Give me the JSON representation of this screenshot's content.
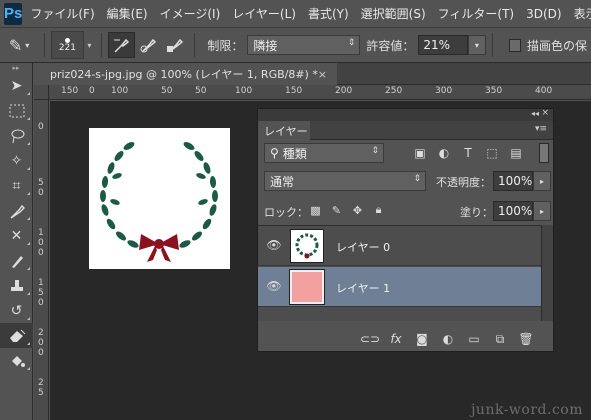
{
  "app": {
    "logo": "Ps"
  },
  "menu": [
    "ファイル(F)",
    "編集(E)",
    "イメージ(I)",
    "レイヤー(L)",
    "書式(Y)",
    "選択範囲(S)",
    "フィルター(T)",
    "3D(D)",
    "表示"
  ],
  "options_bar": {
    "brush_size": "221",
    "limit_label": "制限：",
    "limit_value": "隣接",
    "tolerance_label": "許容値：",
    "tolerance_value": "21%",
    "protect_label": "描画色の保"
  },
  "document": {
    "tab_title": "priz024-s-jpg.jpg @ 100% (レイヤー 1, RGB/8#) *",
    "close": "×"
  },
  "rulers": {
    "horizontal": [
      "150",
      "100",
      "50",
      "0",
      "50",
      "100",
      "150",
      "200",
      "250",
      "300",
      "350",
      "400"
    ],
    "vertical": [
      "0",
      "5",
      "0",
      "1",
      "0",
      "0",
      "1",
      "5",
      "0",
      "2",
      "0",
      "0",
      "2",
      "5"
    ]
  },
  "layers_panel": {
    "tab": "レイヤー",
    "filter_kind": "種類",
    "blend_mode": "通常",
    "opacity_label": "不透明度：",
    "opacity_value": "100%",
    "lock_label": "ロック：",
    "fill_label": "塗り：",
    "fill_value": "100%",
    "layers": [
      {
        "name": "レイヤー 0",
        "selected": false,
        "thumb": "wreath"
      },
      {
        "name": "レイヤー 1",
        "selected": true,
        "thumb": "pink"
      }
    ],
    "selected_color": "#6f7f96",
    "layer1_color": "#f2a0a0"
  },
  "colors": {
    "wreath_green": "#1c5a44",
    "bow_red": "#8b1020"
  },
  "watermark": "junk-word.com"
}
